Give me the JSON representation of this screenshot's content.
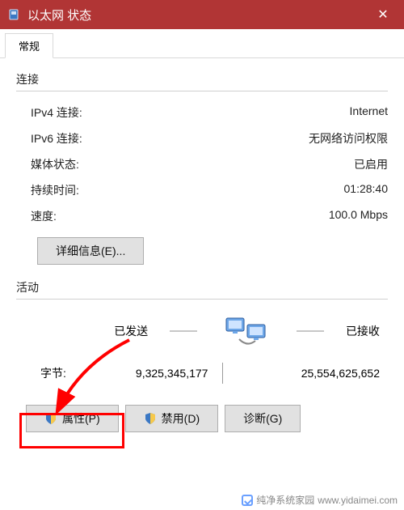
{
  "window": {
    "title": "以太网 状态"
  },
  "tabs": {
    "general": "常规"
  },
  "connection": {
    "section_title": "连接",
    "ipv4_label": "IPv4 连接:",
    "ipv4_value": "Internet",
    "ipv6_label": "IPv6 连接:",
    "ipv6_value": "无网络访问权限",
    "media_label": "媒体状态:",
    "media_value": "已启用",
    "duration_label": "持续时间:",
    "duration_value": "01:28:40",
    "speed_label": "速度:",
    "speed_value": "100.0 Mbps",
    "details_btn": "详细信息(E)..."
  },
  "activity": {
    "section_title": "活动",
    "sent_label": "已发送",
    "received_label": "已接收",
    "bytes_label": "字节:",
    "sent_bytes": "9,325,345,177",
    "received_bytes": "25,554,625,652"
  },
  "buttons": {
    "properties": "属性(P)",
    "disable": "禁用(D)",
    "diagnose": "诊断(G)"
  },
  "watermark": {
    "text": "纯净系统家园",
    "url": "www.yidaimei.com"
  }
}
